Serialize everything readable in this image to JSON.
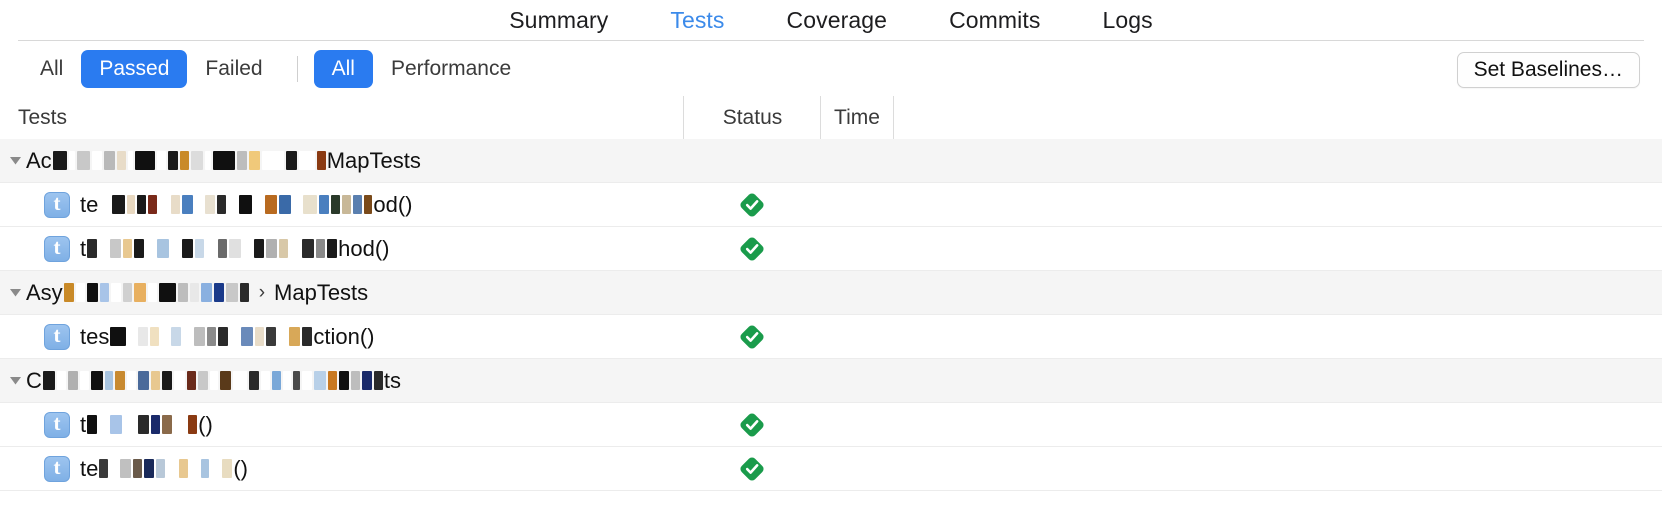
{
  "tabs": [
    {
      "label": "Summary",
      "active": false
    },
    {
      "label": "Tests",
      "active": true
    },
    {
      "label": "Coverage",
      "active": false
    },
    {
      "label": "Commits",
      "active": false
    },
    {
      "label": "Logs",
      "active": false
    }
  ],
  "toolbar": {
    "filters": [
      {
        "label": "All",
        "selected": false
      },
      {
        "label": "Passed",
        "selected": true
      },
      {
        "label": "Failed",
        "selected": false
      }
    ],
    "perf_filters": [
      {
        "label": "All",
        "selected": true
      },
      {
        "label": "Performance",
        "selected": false
      }
    ],
    "set_baselines_label": "Set Baselines…"
  },
  "columns": {
    "tests": "Tests",
    "status": "Status",
    "time": "Time"
  },
  "colors": {
    "accent_blue": "#2a7bf0",
    "tab_active_blue": "#3b8aea",
    "pass_green": "#1a9b4b",
    "group_row_bg": "#f5f5f5",
    "row_border": "#ececec"
  },
  "rows": [
    {
      "type": "group",
      "indent": 0,
      "prefix": "Ac",
      "suffix": "MapTests",
      "separator": "",
      "redacted": true,
      "status": null
    },
    {
      "type": "test",
      "indent": 1,
      "prefix": "te",
      "suffix": "od()",
      "separator": "",
      "redacted": true,
      "icon": "test-case-icon",
      "status": "passed"
    },
    {
      "type": "test",
      "indent": 1,
      "prefix": "t",
      "suffix": "hod()",
      "separator": "",
      "redacted": true,
      "icon": "test-case-icon",
      "status": "passed"
    },
    {
      "type": "group",
      "indent": 0,
      "prefix": "Asy",
      "suffix": "MapTests",
      "separator": "›",
      "redacted": true,
      "status": null
    },
    {
      "type": "test",
      "indent": 1,
      "prefix": "tes",
      "suffix": "ction()",
      "separator": "",
      "redacted": true,
      "icon": "test-case-icon",
      "status": "passed"
    },
    {
      "type": "group",
      "indent": 0,
      "prefix": "C",
      "suffix": "ts",
      "separator": "",
      "redacted": true,
      "status": null
    },
    {
      "type": "test",
      "indent": 1,
      "prefix": "t",
      "suffix": "()",
      "separator": "",
      "redacted": true,
      "icon": "test-case-icon",
      "status": "passed"
    },
    {
      "type": "test",
      "indent": 1,
      "prefix": "te",
      "suffix": "()",
      "separator": "",
      "redacted": true,
      "icon": "test-case-icon",
      "status": "passed"
    }
  ],
  "redaction_patterns": {
    "r0": [
      [
        14,
        "#1a1a1a"
      ],
      [
        6,
        "#ffffff"
      ],
      [
        13,
        "#c8c8c8"
      ],
      [
        10,
        "#ffffff"
      ],
      [
        11,
        "#b9b9b9"
      ],
      [
        9,
        "#e8dcc8"
      ],
      [
        5,
        "#ffffff"
      ],
      [
        20,
        "#101010"
      ],
      [
        9,
        "#ffffff"
      ],
      [
        10,
        "#1a1a1a"
      ],
      [
        9,
        "#c98a28"
      ],
      [
        12,
        "#dcdcdc"
      ],
      [
        6,
        "#ffffff"
      ],
      [
        22,
        "#101010"
      ],
      [
        10,
        "#bdbdbd"
      ],
      [
        11,
        "#f0c97a"
      ],
      [
        22,
        "#ffffff"
      ],
      [
        11,
        "#1a1a1a"
      ],
      [
        16,
        "#ffffff"
      ],
      [
        9,
        "#8a3a12"
      ]
    ],
    "r1": [
      [
        11,
        "#ffffff"
      ],
      [
        13,
        "#1a1a1a"
      ],
      [
        8,
        "#e8d8c0"
      ],
      [
        9,
        "#1a1a1a"
      ],
      [
        9,
        "#7a2a1a"
      ],
      [
        10,
        "#ffffff"
      ],
      [
        9,
        "#e8dcc8"
      ],
      [
        11,
        "#4a7fbf"
      ],
      [
        8,
        "#ffffff"
      ],
      [
        10,
        "#e8e0d0"
      ],
      [
        9,
        "#2a2a2a"
      ],
      [
        9,
        "#ffffff"
      ],
      [
        13,
        "#101010"
      ],
      [
        9,
        "#ffffff"
      ],
      [
        12,
        "#b86a20"
      ],
      [
        12,
        "#3a6aa8"
      ],
      [
        8,
        "#ffffff"
      ],
      [
        14,
        "#e8e0cc"
      ],
      [
        10,
        "#4a7fbf"
      ],
      [
        9,
        "#2a3a2a"
      ],
      [
        9,
        "#c8b898"
      ],
      [
        9,
        "#5a7faf"
      ],
      [
        8,
        "#7a4a1a"
      ]
    ],
    "r2": [
      [
        10,
        "#2a2a2a"
      ],
      [
        9,
        "#ffffff"
      ],
      [
        11,
        "#c8c8c8"
      ],
      [
        9,
        "#e8c890"
      ],
      [
        10,
        "#1a1a1a"
      ],
      [
        9,
        "#ffffff"
      ],
      [
        12,
        "#a8c4e0"
      ],
      [
        9,
        "#ffffff"
      ],
      [
        11,
        "#1a1a1a"
      ],
      [
        9,
        "#c8d8e8"
      ],
      [
        10,
        "#ffffff"
      ],
      [
        9,
        "#6a6a6a"
      ],
      [
        12,
        "#e0e0e0"
      ],
      [
        9,
        "#ffffff"
      ],
      [
        10,
        "#1a1a1a"
      ],
      [
        11,
        "#b0b0b0"
      ],
      [
        9,
        "#d8c8a8"
      ],
      [
        10,
        "#ffffff"
      ],
      [
        12,
        "#2a2a2a"
      ],
      [
        9,
        "#8a8a8a"
      ],
      [
        10,
        "#1a1a1a"
      ]
    ],
    "r3": [
      [
        10,
        "#c98a28"
      ],
      [
        9,
        "#ffffff"
      ],
      [
        11,
        "#101010"
      ],
      [
        9,
        "#a8c4e8"
      ],
      [
        10,
        "#ffffff"
      ],
      [
        9,
        "#d0d0d0"
      ],
      [
        12,
        "#e8b060"
      ],
      [
        9,
        "#ffffff"
      ],
      [
        17,
        "#101010"
      ],
      [
        10,
        "#bdbdbd"
      ],
      [
        9,
        "#e8e8e8"
      ],
      [
        11,
        "#8ab0e0"
      ],
      [
        10,
        "#1a3a8a"
      ],
      [
        12,
        "#c8c8c8"
      ],
      [
        9,
        "#2a2a2a"
      ]
    ],
    "r4": [
      [
        16,
        "#101010"
      ],
      [
        8,
        "#ffffff"
      ],
      [
        10,
        "#e8e8e8"
      ],
      [
        9,
        "#f0e0c0"
      ],
      [
        8,
        "#ffffff"
      ],
      [
        10,
        "#c8d8e8"
      ],
      [
        9,
        "#ffffff"
      ],
      [
        11,
        "#bdbdbd"
      ],
      [
        9,
        "#8a8a8a"
      ],
      [
        10,
        "#2a2a2a"
      ],
      [
        9,
        "#ffffff"
      ],
      [
        12,
        "#6a8aba"
      ],
      [
        9,
        "#e8dcc8"
      ],
      [
        10,
        "#3a3a3a"
      ],
      [
        9,
        "#ffffff"
      ],
      [
        11,
        "#d8a858"
      ],
      [
        10,
        "#2a2a2a"
      ]
    ],
    "r5": [
      [
        12,
        "#1a1a1a"
      ],
      [
        9,
        "#ffffff"
      ],
      [
        10,
        "#b0b0b0"
      ],
      [
        9,
        "#ffffff"
      ],
      [
        12,
        "#101010"
      ],
      [
        8,
        "#a8c4e0"
      ],
      [
        10,
        "#c88a30"
      ],
      [
        9,
        "#ffffff"
      ],
      [
        11,
        "#4a6a9a"
      ],
      [
        9,
        "#e8c890"
      ],
      [
        10,
        "#1a1a1a"
      ],
      [
        11,
        "#ffffff"
      ],
      [
        9,
        "#6a2a1a"
      ],
      [
        10,
        "#c8c8c8"
      ],
      [
        8,
        "#ffffff"
      ],
      [
        11,
        "#5a3a1a"
      ],
      [
        14,
        "#ffffff"
      ],
      [
        10,
        "#2a2a2a"
      ],
      [
        9,
        "#ffffff"
      ],
      [
        9,
        "#7aa8d8"
      ],
      [
        8,
        "#ffffff"
      ],
      [
        7,
        "#4a4a4a"
      ],
      [
        10,
        "#ffffff"
      ],
      [
        12,
        "#b8d0e8"
      ],
      [
        9,
        "#c87820"
      ],
      [
        10,
        "#101010"
      ],
      [
        9,
        "#bdbdbd"
      ],
      [
        10,
        "#1a2a6a"
      ],
      [
        9,
        "#2a2a2a"
      ]
    ],
    "r6": [
      [
        10,
        "#101010"
      ],
      [
        9,
        "#ffffff"
      ],
      [
        12,
        "#a8c4e8"
      ],
      [
        12,
        "#ffffff"
      ],
      [
        11,
        "#2a2a2a"
      ],
      [
        9,
        "#1a2a6a"
      ],
      [
        10,
        "#8a6a4a"
      ],
      [
        12,
        "#ffffff"
      ],
      [
        9,
        "#8a3a12"
      ]
    ],
    "r7": [
      [
        9,
        "#3a3a3a"
      ],
      [
        8,
        "#ffffff"
      ],
      [
        11,
        "#c0c0c0"
      ],
      [
        9,
        "#6a5a4a"
      ],
      [
        10,
        "#1a2a5a"
      ],
      [
        9,
        "#b8c8d8"
      ],
      [
        10,
        "#ffffff"
      ],
      [
        9,
        "#e8c890"
      ],
      [
        9,
        "#ffffff"
      ],
      [
        8,
        "#a8c4e0"
      ],
      [
        9,
        "#ffffff"
      ],
      [
        10,
        "#e8dcc0"
      ]
    ]
  }
}
